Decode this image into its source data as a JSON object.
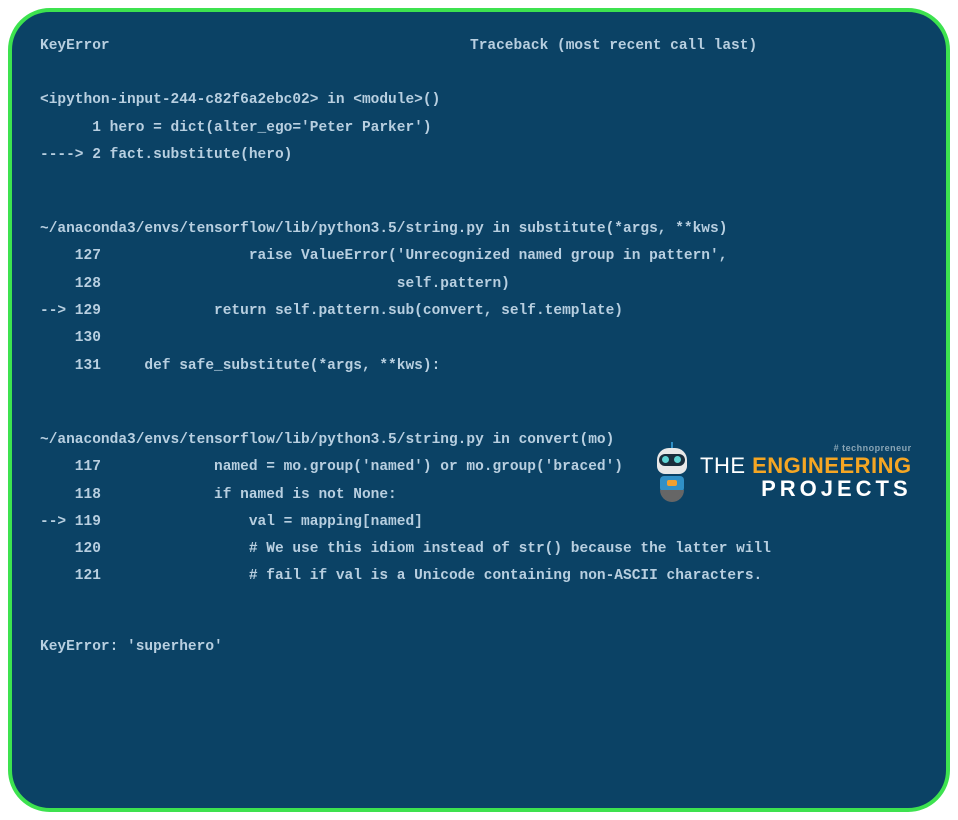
{
  "header": {
    "error_type": "KeyError",
    "traceback_label": "Traceback (most recent call last)"
  },
  "frame1": {
    "location": "<ipython-input-244-c82f6a2ebc02> in <module>()",
    "line1": "      1 hero = dict(alter_ego='Peter Parker')",
    "line2": "----> 2 fact.substitute(hero)"
  },
  "frame2": {
    "location": "~/anaconda3/envs/tensorflow/lib/python3.5/string.py in substitute(*args, **kws)",
    "line1": "    127                 raise ValueError('Unrecognized named group in pattern',",
    "line2": "    128                                  self.pattern)",
    "line3": "--> 129             return self.pattern.sub(convert, self.template)",
    "line4": "    130 ",
    "line5": "    131     def safe_substitute(*args, **kws):"
  },
  "frame3": {
    "location": "~/anaconda3/envs/tensorflow/lib/python3.5/string.py in convert(mo)",
    "line1": "    117             named = mo.group('named') or mo.group('braced')",
    "line2": "    118             if named is not None:",
    "line3": "--> 119                 val = mapping[named]",
    "line4": "    120                 # We use this idiom instead of str() because the latter will",
    "line5": "    121                 # fail if val is a Unicode containing non-ASCII characters."
  },
  "final": {
    "error_line": "KeyError: 'superhero'"
  },
  "watermark": {
    "hashtag": "# technopreneur",
    "the": "THE",
    "eng": "ENGINEERING",
    "proj": "PROJECTS"
  }
}
